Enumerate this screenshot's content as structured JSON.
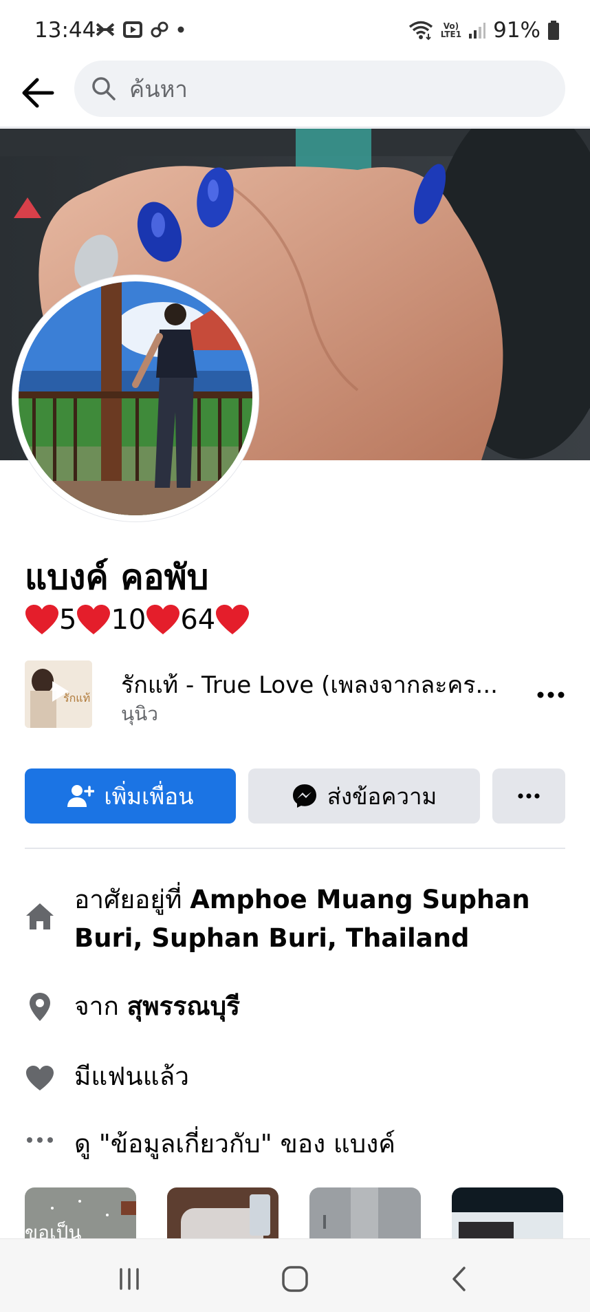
{
  "status_bar": {
    "time": "13:44",
    "battery": "91%",
    "network_label_top": "Vo)",
    "network_label_bottom": "LTE1"
  },
  "search": {
    "placeholder": "ค้นหา",
    "back_icon": "arrow-left-icon",
    "search_icon": "search-icon"
  },
  "profile": {
    "name": "แบงค์ คอพับ",
    "bio_numbers": [
      "5",
      "10",
      "64"
    ]
  },
  "music": {
    "title": "รักแท้ - True Love (เพลงจากละคร...",
    "artist": "นุนิว",
    "cover_text": "รักแท้"
  },
  "actions": {
    "add_friend": "เพิ่มเพื่อน",
    "message": "ส่งข้อความ"
  },
  "details": {
    "lives_prefix": "อาศัยอยู่ที่",
    "lives_line1": "Amphoe Muang Suphan",
    "lives_line2": "Buri, Suphan Buri, Thailand",
    "from_prefix": "จาก",
    "from_place": "สุพรรณบุรี",
    "relationship": "มีแฟนแล้ว",
    "see_about": "ดู \"ข้อมูลเกี่ยวกับ\" ของ แบงค์"
  },
  "photos": {
    "first_caption": "ขอเป็น"
  },
  "colors": {
    "primary": "#1b74e4",
    "secondary_bg": "#e4e6eb",
    "text": "#050505",
    "muted": "#65676b",
    "heart": "#e41e2b"
  }
}
